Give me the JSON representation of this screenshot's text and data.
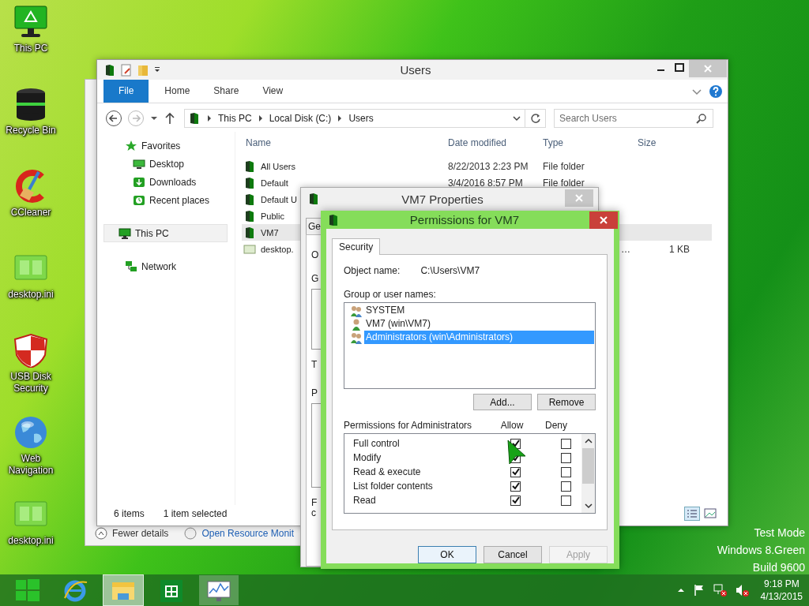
{
  "desktop_icons": [
    {
      "label": "This PC",
      "kind": "monitor"
    },
    {
      "label": "Recycle Bin",
      "kind": "bin"
    },
    {
      "label": "CCleaner",
      "kind": "cleaner"
    },
    {
      "label": "desktop.ini",
      "kind": "file"
    },
    {
      "label": "USB Disk Security",
      "kind": "shield"
    },
    {
      "label": "Web Navigation",
      "kind": "globe"
    },
    {
      "label": "desktop.ini",
      "kind": "file"
    }
  ],
  "back_window": {
    "footer": [
      "Fewer details",
      "Open Resource Monit"
    ]
  },
  "explorer": {
    "title": "Users",
    "ribbon_tabs": [
      {
        "label": "File",
        "kind": "file_menu"
      },
      {
        "label": "Home",
        "kind": "tab"
      },
      {
        "label": "Share",
        "kind": "tab"
      },
      {
        "label": "View",
        "kind": "tab"
      }
    ],
    "breadcrumbs": [
      "This PC",
      "Local Disk (C:)",
      "Users"
    ],
    "search": {
      "placeholder": "Search Users"
    },
    "nav": [
      {
        "label": "Favorites",
        "kind": "favorites",
        "selected": false,
        "children": [
          {
            "label": "Desktop",
            "kind": "desktop",
            "selected": false
          },
          {
            "label": "Downloads",
            "kind": "downloads",
            "selected": false
          },
          {
            "label": "Recent places",
            "kind": "recent",
            "selected": false
          }
        ]
      },
      {
        "label": "This PC",
        "kind": "pc",
        "selected": true
      },
      {
        "label": "Network",
        "kind": "network",
        "selected": false
      }
    ],
    "columns": [
      "Name",
      "Date modified",
      "Type",
      "Size"
    ],
    "rows": [
      {
        "name": "All Users",
        "date": "8/22/2013 2:23 PM",
        "type": "File folder",
        "kind": "folder",
        "selected": false
      },
      {
        "name": "Default",
        "date": "3/4/2016 8:57 PM",
        "type": "File folder",
        "kind": "folder",
        "selected": false
      },
      {
        "name": "Default U",
        "kind": "folder",
        "selected": false
      },
      {
        "name": "Public",
        "kind": "folder",
        "selected": false
      },
      {
        "name": "VM7",
        "kind": "folder",
        "selected": true
      },
      {
        "name": "desktop.",
        "type": "…",
        "size": "1 KB",
        "kind": "file",
        "selected": false
      }
    ],
    "status": [
      "6 items",
      "1 item selected"
    ]
  },
  "properties": {
    "title": "VM7 Properties",
    "tab": "Ge",
    "cut_labels": [
      "O",
      "G",
      "T",
      "P",
      "F",
      "c"
    ]
  },
  "permissions": {
    "title": "Permissions for VM7",
    "tab": {
      "label": "Security",
      "selected": true
    },
    "object_label": "Object name:",
    "object_value": "C:\\Users\\VM7",
    "group_label": "Group or user names:",
    "users": [
      {
        "name": "SYSTEM",
        "kind": "group",
        "selected": false
      },
      {
        "name": "VM7 (win\\VM7)",
        "kind": "user",
        "selected": false
      },
      {
        "name": "Administrators (win\\Administrators)",
        "kind": "group",
        "selected": true
      }
    ],
    "add_button": "Add...",
    "remove_button": "Remove",
    "perm_label": "Permissions for Administrators",
    "allow_label": "Allow",
    "deny_label": "Deny",
    "perms": [
      {
        "name": "Full control",
        "allow": true,
        "deny": false
      },
      {
        "name": "Modify",
        "allow": true,
        "deny": false
      },
      {
        "name": "Read & execute",
        "allow": true,
        "deny": false
      },
      {
        "name": "List folder contents",
        "allow": true,
        "deny": false
      },
      {
        "name": "Read",
        "allow": true,
        "deny": false
      }
    ],
    "buttons": [
      {
        "label": "OK",
        "disabled": false
      },
      {
        "label": "Cancel",
        "disabled": false
      },
      {
        "label": "Apply",
        "disabled": true
      }
    ]
  },
  "system_notice": [
    "Test Mode",
    "Windows 8.Green",
    "Build 9600"
  ],
  "taskbar": {
    "apps": [
      {
        "kind": "start",
        "selected": false
      },
      {
        "kind": "browser",
        "selected": false
      },
      {
        "kind": "explorer",
        "selected": true
      },
      {
        "kind": "store",
        "selected": false
      },
      {
        "kind": "monitor",
        "selected": false
      }
    ],
    "time": "9:18 PM",
    "date": "4/13/2015"
  }
}
